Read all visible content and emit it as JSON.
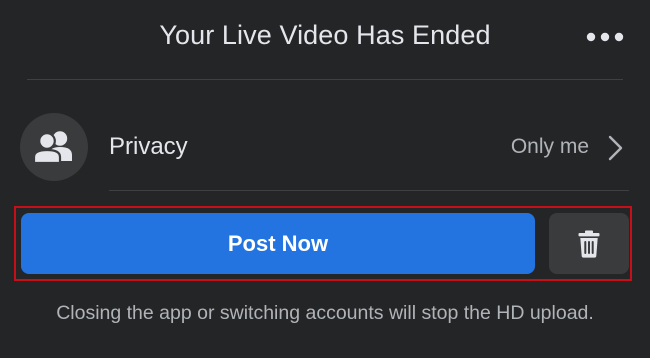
{
  "header": {
    "title": "Your Live Video Has Ended",
    "more_icon": "more-horizontal-icon"
  },
  "privacy": {
    "icon": "people-icon",
    "label": "Privacy",
    "value": "Only me",
    "chevron_icon": "chevron-right-icon"
  },
  "actions": {
    "post_label": "Post Now",
    "post_color": "#2374e1",
    "delete_icon": "trash-icon",
    "highlight_color": "#c50f19"
  },
  "note": "Closing the app or switching accounts will stop the HD upload."
}
